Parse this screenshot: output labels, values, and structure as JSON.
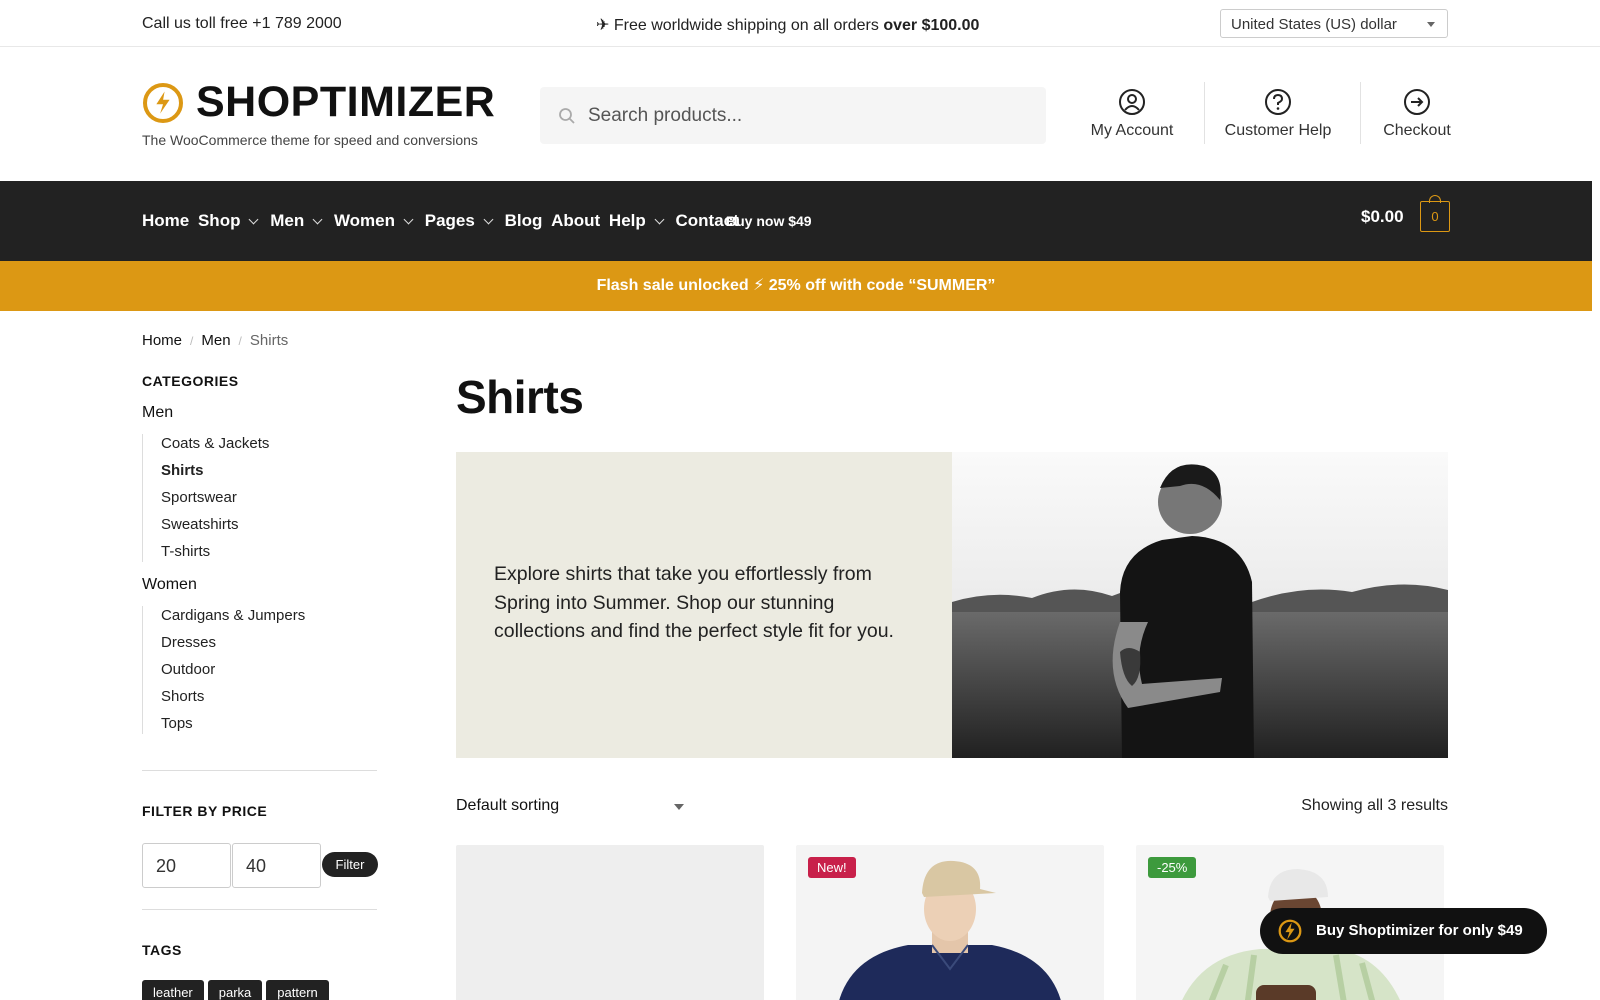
{
  "topbar": {
    "phone": "Call us toll free +1 789 2000",
    "shipping_prefix": "✈ Free worldwide shipping on all orders ",
    "shipping_bold": "over $100.00",
    "currency": "United States (US) dollar"
  },
  "logo": {
    "name": "SHOPTIMIZER",
    "tagline": "The WooCommerce theme for speed and conversions"
  },
  "search": {
    "placeholder": "Search products..."
  },
  "header_links": [
    {
      "label": "My Account",
      "icon": "user-icon"
    },
    {
      "label": "Customer Help",
      "icon": "help-icon"
    },
    {
      "label": "Checkout",
      "icon": "arrow-circle-icon"
    }
  ],
  "nav": {
    "items": [
      "Home",
      "Shop",
      "Men",
      "Women",
      "Pages",
      "Blog",
      "About",
      "Help",
      "Contact"
    ],
    "buy": "Buy now $49",
    "cart_total": "$0.00",
    "cart_count": "0"
  },
  "flash": "Flash sale unlocked ⚡ 25% off with code “SUMMER”",
  "breadcrumb": [
    "Home",
    "Men",
    "Shirts"
  ],
  "sidebar": {
    "categories_heading": "CATEGORIES",
    "men": "Men",
    "men_items": [
      "Coats & Jackets",
      "Shirts",
      "Sportswear",
      "Sweatshirts",
      "T-shirts"
    ],
    "women": "Women",
    "women_items": [
      "Cardigans & Jumpers",
      "Dresses",
      "Outdoor",
      "Shorts",
      "Tops"
    ],
    "filter_heading": "FILTER BY PRICE",
    "price_min": "20",
    "price_max": "40",
    "filter_button": "Filter",
    "tags_heading": "TAGS",
    "tags": [
      "leather",
      "parka",
      "pattern"
    ]
  },
  "main": {
    "title": "Shirts",
    "banner_text": "Explore shirts that take you effortlessly from Spring into Summer. Shop our stunning collections and find the perfect style fit for you.",
    "sort": "Default sorting",
    "count": "Showing all 3 results",
    "badges": {
      "new": "New!",
      "sale": "-25%"
    }
  },
  "float_buy": "Buy Shoptimizer for only $49",
  "colors": {
    "accent": "#dc9814",
    "nav": "#222222",
    "new_badge": "#c8204a",
    "sale_badge": "#3d9a3d"
  }
}
